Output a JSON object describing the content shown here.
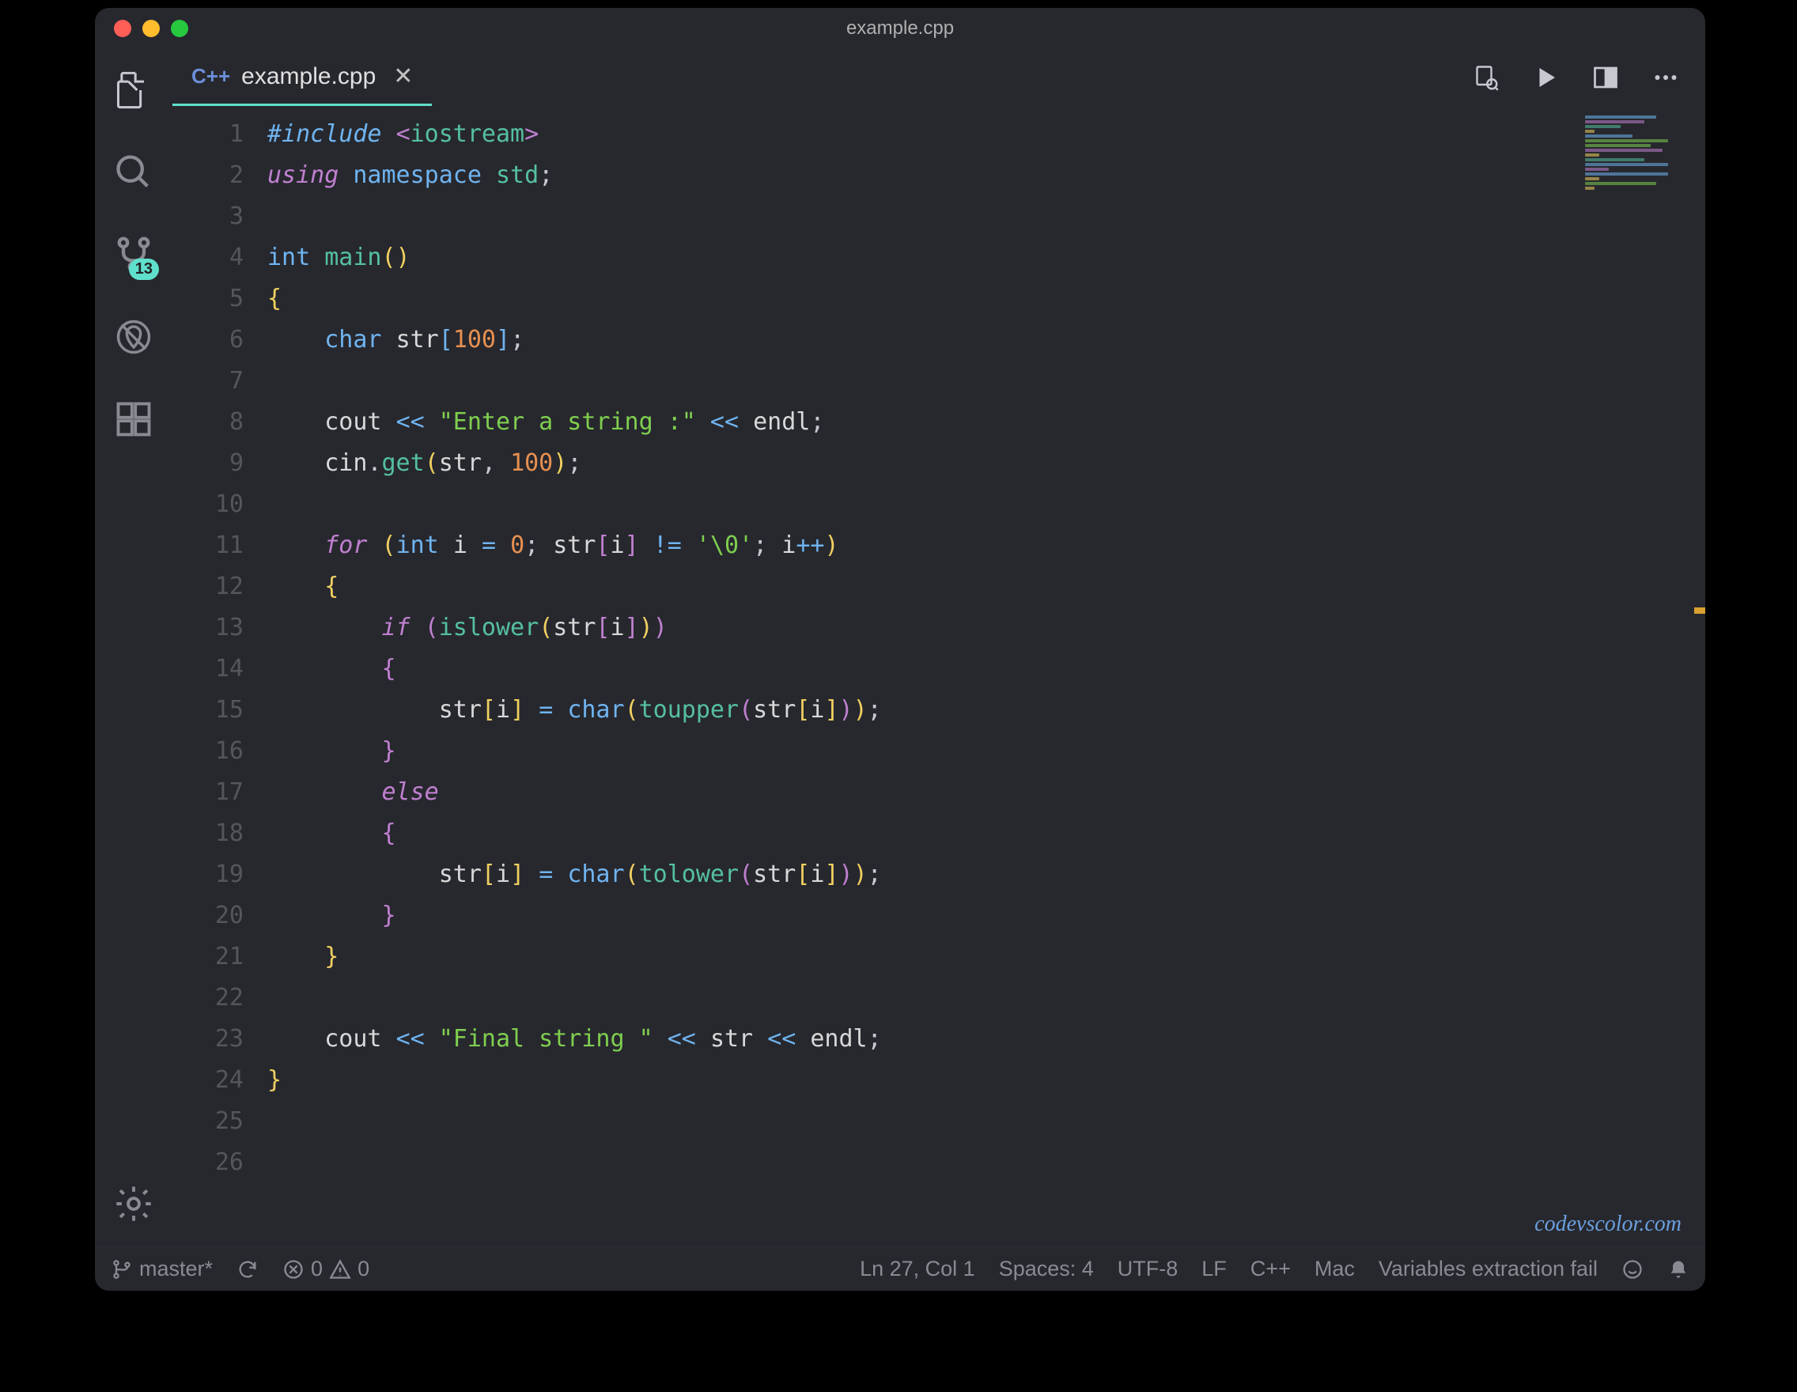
{
  "window": {
    "title": "example.cpp"
  },
  "tab": {
    "lang_prefix": "C++",
    "filename": "example.cpp",
    "close_glyph": "✕"
  },
  "activitybar": {
    "scm_badge": "13"
  },
  "editor": {
    "line_count": 26,
    "tokens": [
      [
        [
          "c-keyword-i",
          "#include"
        ],
        [
          "c-punct",
          " "
        ],
        [
          "c-punct-c",
          "<"
        ],
        [
          "c-namespace",
          "iostream"
        ],
        [
          "c-punct-c",
          ">"
        ]
      ],
      [
        [
          "c-ctrl",
          "using"
        ],
        [
          "c-punct",
          " "
        ],
        [
          "c-keyword",
          "namespace"
        ],
        [
          "c-punct",
          " "
        ],
        [
          "c-namespace",
          "std"
        ],
        [
          "c-punct",
          ";"
        ]
      ],
      [],
      [
        [
          "c-type2",
          "int"
        ],
        [
          "c-punct",
          " "
        ],
        [
          "c-func",
          "main"
        ],
        [
          "c-brace",
          "()"
        ]
      ],
      [
        [
          "c-brace",
          "{"
        ]
      ],
      [
        [
          "c-punct",
          "    "
        ],
        [
          "c-type2",
          "char"
        ],
        [
          "c-punct",
          " "
        ],
        [
          "c-var",
          "str"
        ],
        [
          "c-bracket",
          "["
        ],
        [
          "c-num",
          "100"
        ],
        [
          "c-bracket",
          "]"
        ],
        [
          "c-punct",
          ";"
        ]
      ],
      [],
      [
        [
          "c-punct",
          "    "
        ],
        [
          "c-var",
          "cout"
        ],
        [
          "c-punct",
          " "
        ],
        [
          "c-keyword",
          "<<"
        ],
        [
          "c-punct",
          " "
        ],
        [
          "c-string",
          "\"Enter a string :\""
        ],
        [
          "c-punct",
          " "
        ],
        [
          "c-keyword",
          "<<"
        ],
        [
          "c-punct",
          " "
        ],
        [
          "c-var",
          "endl"
        ],
        [
          "c-punct",
          ";"
        ]
      ],
      [
        [
          "c-punct",
          "    "
        ],
        [
          "c-var",
          "cin"
        ],
        [
          "c-punct",
          "."
        ],
        [
          "c-func",
          "get"
        ],
        [
          "c-brace",
          "("
        ],
        [
          "c-var",
          "str"
        ],
        [
          "c-punct",
          ", "
        ],
        [
          "c-num",
          "100"
        ],
        [
          "c-brace",
          ")"
        ],
        [
          "c-punct",
          ";"
        ]
      ],
      [],
      [
        [
          "c-punct",
          "    "
        ],
        [
          "c-ctrl",
          "for"
        ],
        [
          "c-punct",
          " "
        ],
        [
          "c-brace",
          "("
        ],
        [
          "c-type2",
          "int"
        ],
        [
          "c-punct",
          " "
        ],
        [
          "c-var",
          "i"
        ],
        [
          "c-punct",
          " "
        ],
        [
          "c-keyword",
          "="
        ],
        [
          "c-punct",
          " "
        ],
        [
          "c-num",
          "0"
        ],
        [
          "c-punct",
          "; "
        ],
        [
          "c-var",
          "str"
        ],
        [
          "c-brace2",
          "["
        ],
        [
          "c-var",
          "i"
        ],
        [
          "c-brace2",
          "]"
        ],
        [
          "c-punct",
          " "
        ],
        [
          "c-keyword",
          "!="
        ],
        [
          "c-punct",
          " "
        ],
        [
          "c-string",
          "'\\0'"
        ],
        [
          "c-punct",
          "; "
        ],
        [
          "c-var",
          "i"
        ],
        [
          "c-keyword",
          "++"
        ],
        [
          "c-brace",
          ")"
        ]
      ],
      [
        [
          "c-punct",
          "    "
        ],
        [
          "c-brace",
          "{"
        ]
      ],
      [
        [
          "c-punct",
          "        "
        ],
        [
          "c-ctrl",
          "if"
        ],
        [
          "c-punct",
          " "
        ],
        [
          "c-brace2",
          "("
        ],
        [
          "c-func",
          "islower"
        ],
        [
          "c-brace",
          "("
        ],
        [
          "c-var",
          "str"
        ],
        [
          "c-brace2",
          "["
        ],
        [
          "c-var",
          "i"
        ],
        [
          "c-brace2",
          "]"
        ],
        [
          "c-brace",
          ")"
        ],
        [
          "c-brace2",
          ")"
        ]
      ],
      [
        [
          "c-punct",
          "        "
        ],
        [
          "c-brace2",
          "{"
        ]
      ],
      [
        [
          "c-punct",
          "            "
        ],
        [
          "c-var",
          "str"
        ],
        [
          "c-brace",
          "["
        ],
        [
          "c-var",
          "i"
        ],
        [
          "c-brace",
          "]"
        ],
        [
          "c-punct",
          " "
        ],
        [
          "c-keyword",
          "="
        ],
        [
          "c-punct",
          " "
        ],
        [
          "c-type2",
          "char"
        ],
        [
          "c-brace",
          "("
        ],
        [
          "c-func",
          "toupper"
        ],
        [
          "c-brace2",
          "("
        ],
        [
          "c-var",
          "str"
        ],
        [
          "c-brace",
          "["
        ],
        [
          "c-var",
          "i"
        ],
        [
          "c-brace",
          "]"
        ],
        [
          "c-brace2",
          ")"
        ],
        [
          "c-brace",
          ")"
        ],
        [
          "c-punct",
          ";"
        ]
      ],
      [
        [
          "c-punct",
          "        "
        ],
        [
          "c-brace2",
          "}"
        ]
      ],
      [
        [
          "c-punct",
          "        "
        ],
        [
          "c-ctrl",
          "else"
        ]
      ],
      [
        [
          "c-punct",
          "        "
        ],
        [
          "c-brace2",
          "{"
        ]
      ],
      [
        [
          "c-punct",
          "            "
        ],
        [
          "c-var",
          "str"
        ],
        [
          "c-brace",
          "["
        ],
        [
          "c-var",
          "i"
        ],
        [
          "c-brace",
          "]"
        ],
        [
          "c-punct",
          " "
        ],
        [
          "c-keyword",
          "="
        ],
        [
          "c-punct",
          " "
        ],
        [
          "c-type2",
          "char"
        ],
        [
          "c-brace",
          "("
        ],
        [
          "c-func",
          "tolower"
        ],
        [
          "c-brace2",
          "("
        ],
        [
          "c-var",
          "str"
        ],
        [
          "c-brace",
          "["
        ],
        [
          "c-var",
          "i"
        ],
        [
          "c-brace",
          "]"
        ],
        [
          "c-brace2",
          ")"
        ],
        [
          "c-brace",
          ")"
        ],
        [
          "c-punct",
          ";"
        ]
      ],
      [
        [
          "c-punct",
          "        "
        ],
        [
          "c-brace2",
          "}"
        ]
      ],
      [
        [
          "c-punct",
          "    "
        ],
        [
          "c-brace",
          "}"
        ]
      ],
      [],
      [
        [
          "c-punct",
          "    "
        ],
        [
          "c-var",
          "cout"
        ],
        [
          "c-punct",
          " "
        ],
        [
          "c-keyword",
          "<<"
        ],
        [
          "c-punct",
          " "
        ],
        [
          "c-string",
          "\"Final string \""
        ],
        [
          "c-punct",
          " "
        ],
        [
          "c-keyword",
          "<<"
        ],
        [
          "c-punct",
          " "
        ],
        [
          "c-var",
          "str"
        ],
        [
          "c-punct",
          " "
        ],
        [
          "c-keyword",
          "<<"
        ],
        [
          "c-punct",
          " "
        ],
        [
          "c-var",
          "endl"
        ],
        [
          "c-punct",
          ";"
        ]
      ],
      [
        [
          "c-brace",
          "}"
        ]
      ],
      [],
      []
    ]
  },
  "watermark": "codevscolor.com",
  "statusbar": {
    "branch": "master*",
    "errors": "0",
    "warnings": "0",
    "cursor": "Ln 27, Col 1",
    "spaces": "Spaces: 4",
    "encoding": "UTF-8",
    "eol": "LF",
    "language": "C++",
    "os": "Mac",
    "extra": "Variables extraction fail"
  }
}
